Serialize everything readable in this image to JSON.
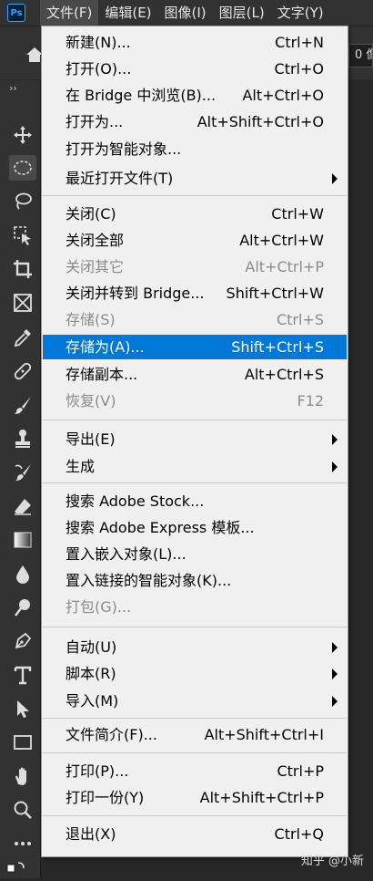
{
  "app": {
    "logo": "Ps"
  },
  "menubar": {
    "items": [
      {
        "label": "文件(F)",
        "active": true
      },
      {
        "label": "编辑(E)"
      },
      {
        "label": "图像(I)"
      },
      {
        "label": "图层(L)"
      },
      {
        "label": "文字(Y)"
      }
    ]
  },
  "options": {
    "field_value": "0 像"
  },
  "toolbar": {
    "collapse_label": "››"
  },
  "file_menu": {
    "items": [
      {
        "label": "新建(N)...",
        "shortcut": "Ctrl+N"
      },
      {
        "label": "打开(O)...",
        "shortcut": "Ctrl+O"
      },
      {
        "label": "在 Bridge 中浏览(B)...",
        "shortcut": "Alt+Ctrl+O"
      },
      {
        "label": "打开为...",
        "shortcut": "Alt+Shift+Ctrl+O"
      },
      {
        "label": "打开为智能对象...",
        "shortcut": ""
      },
      {
        "label": "最近打开文件(T)",
        "shortcut": "",
        "submenu": true
      },
      {
        "label": "关闭(C)",
        "shortcut": "Ctrl+W"
      },
      {
        "label": "关闭全部",
        "shortcut": "Alt+Ctrl+W"
      },
      {
        "label": "关闭其它",
        "shortcut": "Alt+Ctrl+P",
        "disabled": true
      },
      {
        "label": "关闭并转到 Bridge...",
        "shortcut": "Shift+Ctrl+W"
      },
      {
        "label": "存储(S)",
        "shortcut": "Ctrl+S",
        "disabled": true
      },
      {
        "label": "存储为(A)...",
        "shortcut": "Shift+Ctrl+S",
        "highlighted": true
      },
      {
        "label": "存储副本...",
        "shortcut": "Alt+Ctrl+S"
      },
      {
        "label": "恢复(V)",
        "shortcut": "F12",
        "disabled": true
      },
      {
        "label": "导出(E)",
        "shortcut": "",
        "submenu": true
      },
      {
        "label": "生成",
        "shortcut": "",
        "submenu": true
      },
      {
        "label": "搜索 Adobe Stock...",
        "shortcut": ""
      },
      {
        "label": "搜索 Adobe Express 模板...",
        "shortcut": ""
      },
      {
        "label": "置入嵌入对象(L)...",
        "shortcut": ""
      },
      {
        "label": "置入链接的智能对象(K)...",
        "shortcut": ""
      },
      {
        "label": "打包(G)...",
        "shortcut": "",
        "disabled": true
      },
      {
        "label": "自动(U)",
        "shortcut": "",
        "submenu": true
      },
      {
        "label": "脚本(R)",
        "shortcut": "",
        "submenu": true
      },
      {
        "label": "导入(M)",
        "shortcut": "",
        "submenu": true
      },
      {
        "label": "文件简介(F)...",
        "shortcut": "Alt+Shift+Ctrl+I"
      },
      {
        "label": "打印(P)...",
        "shortcut": "Ctrl+P"
      },
      {
        "label": "打印一份(Y)",
        "shortcut": "Alt+Shift+Ctrl+P"
      },
      {
        "label": "退出(X)",
        "shortcut": "Ctrl+Q"
      }
    ]
  },
  "watermark": "知乎 @小新",
  "colors": {
    "highlight": "#0078d7",
    "menu_bg": "#f0f0f0",
    "ui_bg": "#323232"
  }
}
